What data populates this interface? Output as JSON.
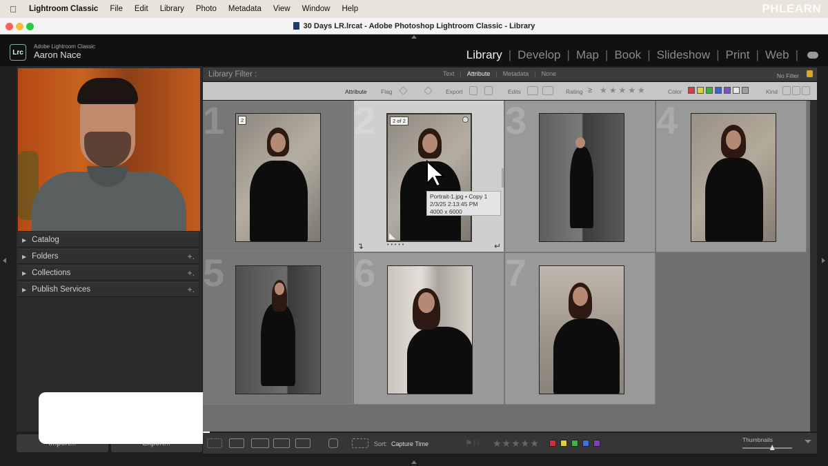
{
  "menubar": {
    "app_name": "Lightroom Classic",
    "items": [
      "File",
      "Edit",
      "Library",
      "Photo",
      "Metadata",
      "View",
      "Window",
      "Help"
    ],
    "watermark": "PHLEARN"
  },
  "window": {
    "title": "30 Days LR.lrcat - Adobe Photoshop Lightroom Classic - Library"
  },
  "identity": {
    "badge": "Lrc",
    "product": "Adobe Lightroom Classic",
    "user": "Aaron Nace"
  },
  "modules": [
    {
      "label": "Library",
      "active": true
    },
    {
      "label": "Develop"
    },
    {
      "label": "Map"
    },
    {
      "label": "Book"
    },
    {
      "label": "Slideshow"
    },
    {
      "label": "Print"
    },
    {
      "label": "Web"
    }
  ],
  "left_panel": {
    "sections": [
      {
        "label": "Catalog",
        "has_plus": false
      },
      {
        "label": "Folders",
        "has_plus": true
      },
      {
        "label": "Collections",
        "has_plus": true
      },
      {
        "label": "Publish Services",
        "has_plus": true
      }
    ],
    "import_label": "Import...",
    "export_label": "Export..."
  },
  "library_filter": {
    "label": "Library Filter :",
    "tabs": [
      "Text",
      "Attribute",
      "Metadata",
      "None"
    ],
    "active_tab": "Attribute",
    "preset": "No Filter"
  },
  "attribute_bar": {
    "attribute": "Attribute",
    "flag": "Flag",
    "export": "Export",
    "edits": "Edits",
    "rating": "Rating",
    "rating_op": "≥",
    "color": "Color",
    "kind": "Kind",
    "color_swatches": [
      "#d04040",
      "#d8d040",
      "#40b040",
      "#4060d0",
      "#8050c0",
      "#e8e8e8",
      "#a0a0a0"
    ]
  },
  "grid": {
    "cells": [
      {
        "index": "1",
        "badge": "2",
        "selected": false
      },
      {
        "index": "2",
        "badge": "2 of 2",
        "selected": true
      },
      {
        "index": "3",
        "badge": "",
        "selected": false
      },
      {
        "index": "4",
        "badge": "",
        "selected": false
      },
      {
        "index": "5",
        "badge": "",
        "selected": false
      },
      {
        "index": "6",
        "badge": "",
        "selected": false
      },
      {
        "index": "7",
        "badge": "",
        "selected": false
      }
    ],
    "tooltip": {
      "line1": "Portrait-1.jpg  •  Copy 1",
      "line2": "2/3/25 2:13:45 PM",
      "line3": "4000 x 6000"
    }
  },
  "toolbar": {
    "sort_label": "Sort:",
    "sort_value": "Capture Time",
    "thumbnails_label": "Thumbnails",
    "thumbnails_size": 0.6,
    "color_labels": [
      "#d03040",
      "#e0d030",
      "#40b040",
      "#4070e0",
      "#8040c0"
    ]
  }
}
